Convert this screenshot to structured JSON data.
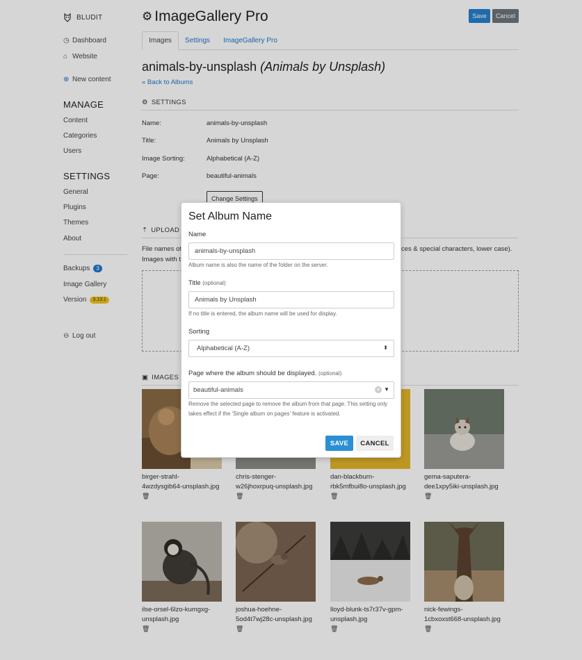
{
  "sidebar": {
    "brand": "BLUDIT",
    "dashboard": "Dashboard",
    "website": "Website",
    "new_content": "New content",
    "manage_heading": "MANAGE",
    "content": "Content",
    "categories": "Categories",
    "users": "Users",
    "settings_heading": "SETTINGS",
    "general": "General",
    "plugins": "Plugins",
    "themes": "Themes",
    "about": "About",
    "backups": "Backups",
    "backups_count": "3",
    "image_gallery": "Image Gallery",
    "version": "Version",
    "version_number": "3.13.1",
    "logout": "Log out"
  },
  "header": {
    "title": "ImageGallery Pro",
    "save": "Save",
    "cancel": "Cancel"
  },
  "tabs": [
    "Images",
    "Settings",
    "ImageGallery Pro"
  ],
  "album": {
    "name": "animals-by-unsplash",
    "title_display": "(Animals by Unsplash)",
    "back": "« Back to Albums"
  },
  "settings": {
    "heading": "SETTINGS",
    "rows": [
      {
        "label": "Name:",
        "value": "animals-by-unsplash"
      },
      {
        "label": "Title:",
        "value": "Animals by Unsplash"
      },
      {
        "label": "Image Sorting:",
        "value": "Alphabetical (A-Z)"
      },
      {
        "label": "Page:",
        "value": "beautiful-animals"
      }
    ],
    "change_button": "Change Settings"
  },
  "upload": {
    "heading": "UPLOAD",
    "text_left": "File names of",
    "text_right": "ces & special characters, lower case).",
    "text_line2": "Images with t"
  },
  "images": {
    "heading": "IMAGES",
    "items": [
      {
        "name": "birger-strahl-4wzdysgib64-unsplash.jpg",
        "line1": "birger-strahl-",
        "line2": "4wzdysgib64-unsplash.jpg"
      },
      {
        "name": "chris-stenger-w26jhoxrpuq-unsplash.jpg",
        "line1": "chris-stenger-",
        "line2": "w26jhoxrpuq-unsplash.jpg"
      },
      {
        "name": "dan-blackburn-rbk5mfbui8o-unsplash.jpg",
        "line1": "dan-blackburn-",
        "line2": "rbk5mfbui8o-unsplash.jpg"
      },
      {
        "name": "gema-saputera-dee1xpy5iki-unsplash.jpg",
        "line1": "gema-saputera-",
        "line2": "dee1xpy5iki-unsplash.jpg"
      },
      {
        "name": "ilse-orsel-6lzo-kumgxg-unsplash.jpg",
        "line1": "ilse-orsel-6lzo-kumgxg-",
        "line2": "unsplash.jpg"
      },
      {
        "name": "joshua-hoehne-5od4t7wj28c-unsplash.jpg",
        "line1": "joshua-hoehne-",
        "line2": "5od4t7wj28c-unsplash.jpg"
      },
      {
        "name": "lloyd-blunk-ts7r37v-gpm-unsplash.jpg",
        "line1": "lloyd-blunk-ts7r37v-gpm-",
        "line2": "unsplash.jpg"
      },
      {
        "name": "nick-fewings-1cbxoxst668-unsplash.jpg",
        "line1": "nick-fewings-",
        "line2": "1cbxoxst668-unsplash.jpg"
      }
    ]
  },
  "modal": {
    "title": "Set Album Name",
    "name_label": "Name",
    "name_value": "animals-by-unsplash",
    "name_help": "Album name is also the name of the folder on the server.",
    "title_label": "Title",
    "title_optional": "(optional)",
    "title_value": "Animals by Unsplash",
    "title_help": "If no title is entered, the album name will be used for display.",
    "sorting_label": "Sorting",
    "sorting_value": "Alphabetical (A-Z)",
    "page_label": "Page where the album should be displayed.",
    "page_optional": "(optional)",
    "page_value": "beautiful-animals",
    "page_help": "Remove the selected page to remove the album from that page. This setting only takes effect if the 'Single album on pages' feature is activated.",
    "save": "SAVE",
    "cancel": "CANCEL"
  },
  "colors": {
    "accent": "#2078d0",
    "save_button": "#2580cc",
    "cancel_button": "#6c757d",
    "version_badge": "#f0c419"
  }
}
